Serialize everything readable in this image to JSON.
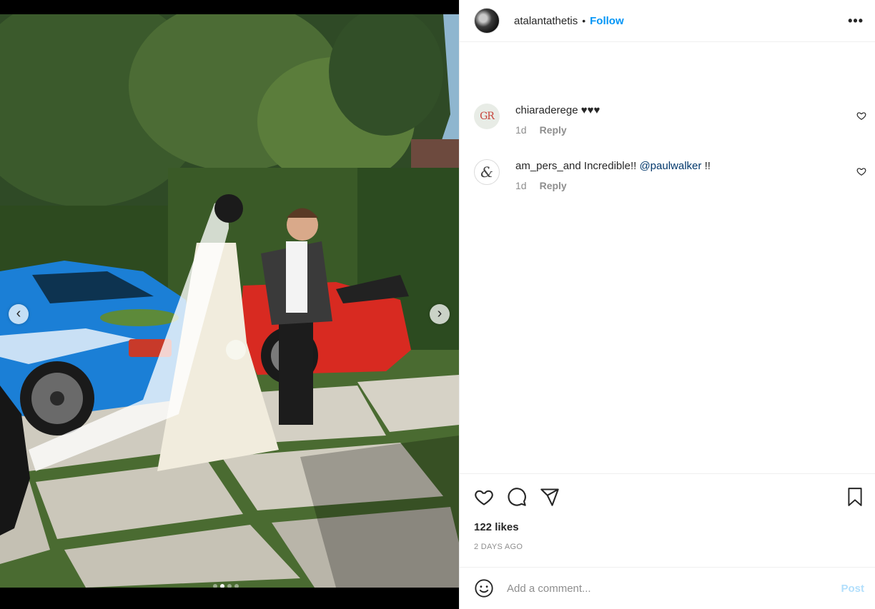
{
  "post": {
    "author": "atalantathetis",
    "separator": "•",
    "follow_label": "Follow",
    "more_label": "•••"
  },
  "media": {
    "description_icon": "photo",
    "prev_label": "‹",
    "next_label": "›",
    "slide_count": 4,
    "active_slide": 2
  },
  "comments": [
    {
      "avatar_text": "GR",
      "author": "chiaraderege",
      "text": "♥♥♥",
      "age": "1d",
      "reply_label": "Reply"
    },
    {
      "avatar_text": "&",
      "author": "am_pers_and",
      "text": "Incredible!!",
      "mention": "@paulwalker",
      "text_after": "!!",
      "age": "1d",
      "reply_label": "Reply"
    }
  ],
  "engagement": {
    "likes": "122 likes",
    "timestamp": "2 DAYS AGO"
  },
  "composer": {
    "placeholder": "Add a comment...",
    "post_label": "Post"
  },
  "colors": {
    "accent": "#0095f6",
    "post_disabled": "#b2dffc",
    "mention": "#00376b",
    "secondary_text": "#8e8e8e"
  }
}
